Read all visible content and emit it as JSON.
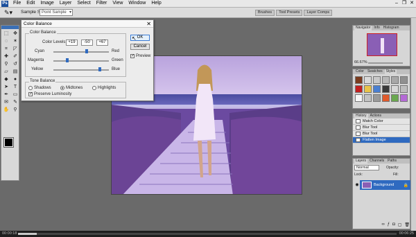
{
  "menubar": {
    "logo": "Ps",
    "items": [
      "File",
      "Edit",
      "Image",
      "Layer",
      "Select",
      "Filter",
      "View",
      "Window",
      "Help"
    ]
  },
  "optbar": {
    "sample_label": "Sample Size:",
    "sample_value": "Point Sample",
    "palette_tabs": [
      "Brushes",
      "Tool Presets",
      "Layer Comps"
    ]
  },
  "dialog": {
    "title": "Color Balance",
    "group_title": "Color Balance",
    "levels_label": "Color Levels:",
    "levels": [
      "+19",
      "-50",
      "+67"
    ],
    "sliders": [
      {
        "left": "Cyan",
        "right": "Red",
        "value": 19
      },
      {
        "left": "Magenta",
        "right": "Green",
        "value": -50
      },
      {
        "left": "Yellow",
        "right": "Blue",
        "value": 67
      }
    ],
    "ok": "OK",
    "cancel": "Cancel",
    "preview": "Preview",
    "tone_title": "Tone Balance",
    "shadows": "Shadows",
    "midtones": "Midtones",
    "highlights": "Highlights",
    "preserve": "Preserve Luminosity"
  },
  "navigator": {
    "tabs": [
      "Navigator",
      "Info",
      "Histogram"
    ],
    "zoom": "66.67%"
  },
  "styles": {
    "tabs": [
      "Color",
      "Swatches",
      "Styles"
    ],
    "colors": [
      "#7a3b1e",
      "#d9d9d9",
      "#c9c9c9",
      "#b8b8b8",
      "#a8a8a8",
      "#909090",
      "#c21f1f",
      "#e8c34a",
      "#4a7fd1",
      "#3a3a3a",
      "#d8d8d8",
      "#bdbdbd",
      "#f7f7f7",
      "#c2c2c2",
      "#9a9a9a",
      "#e05a2b",
      "#6aa84f",
      "#b56ad6"
    ]
  },
  "history": {
    "tabs": [
      "History",
      "Actions"
    ],
    "items": [
      "Match Color",
      "Blur Tool",
      "Blur Tool",
      "Flatten Image"
    ]
  },
  "layers": {
    "tabs": [
      "Layers",
      "Channels",
      "Paths"
    ],
    "blend": "Normal",
    "opacity_label": "Opacity:",
    "lock_label": "Lock:",
    "fill_label": "Fill:",
    "layer_name": "Background"
  },
  "status": {
    "left": "00:00:18",
    "right": "00:06:25",
    "progress": 0.05
  },
  "colors": {
    "accent": "#2f6ac0",
    "image_tint": "#6b4aa0"
  }
}
